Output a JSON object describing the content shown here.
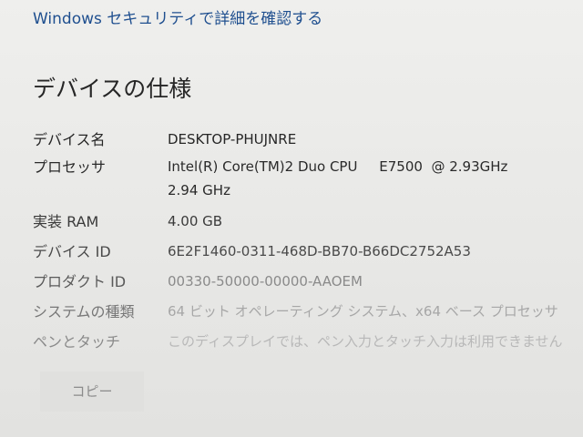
{
  "header": {
    "link": "Windows セキュリティで詳細を確認する"
  },
  "section": {
    "title": "デバイスの仕様"
  },
  "specs": [
    {
      "label": "デバイス名",
      "value": "DESKTOP-PHUJNRE"
    },
    {
      "label": "プロセッサ",
      "value": "Intel(R) Core(TM)2 Duo CPU     E7500  @ 2.93GHz\n2.94 GHz"
    },
    {
      "label": "実装 RAM",
      "value": "4.00 GB"
    },
    {
      "label": "デバイス ID",
      "value": "6E2F1460-0311-468D-BB70-B66DC2752A53"
    },
    {
      "label": "プロダクト ID",
      "value": "00330-50000-00000-AAOEM"
    },
    {
      "label": "システムの種類",
      "value": "64 ビット オペレーティング システム、x64 ベース プロセッサ"
    },
    {
      "label": "ペンとタッチ",
      "value": "このディスプレイでは、ペン入力とタッチ入力は利用できません"
    }
  ],
  "actions": {
    "copy_label": "コピー"
  }
}
